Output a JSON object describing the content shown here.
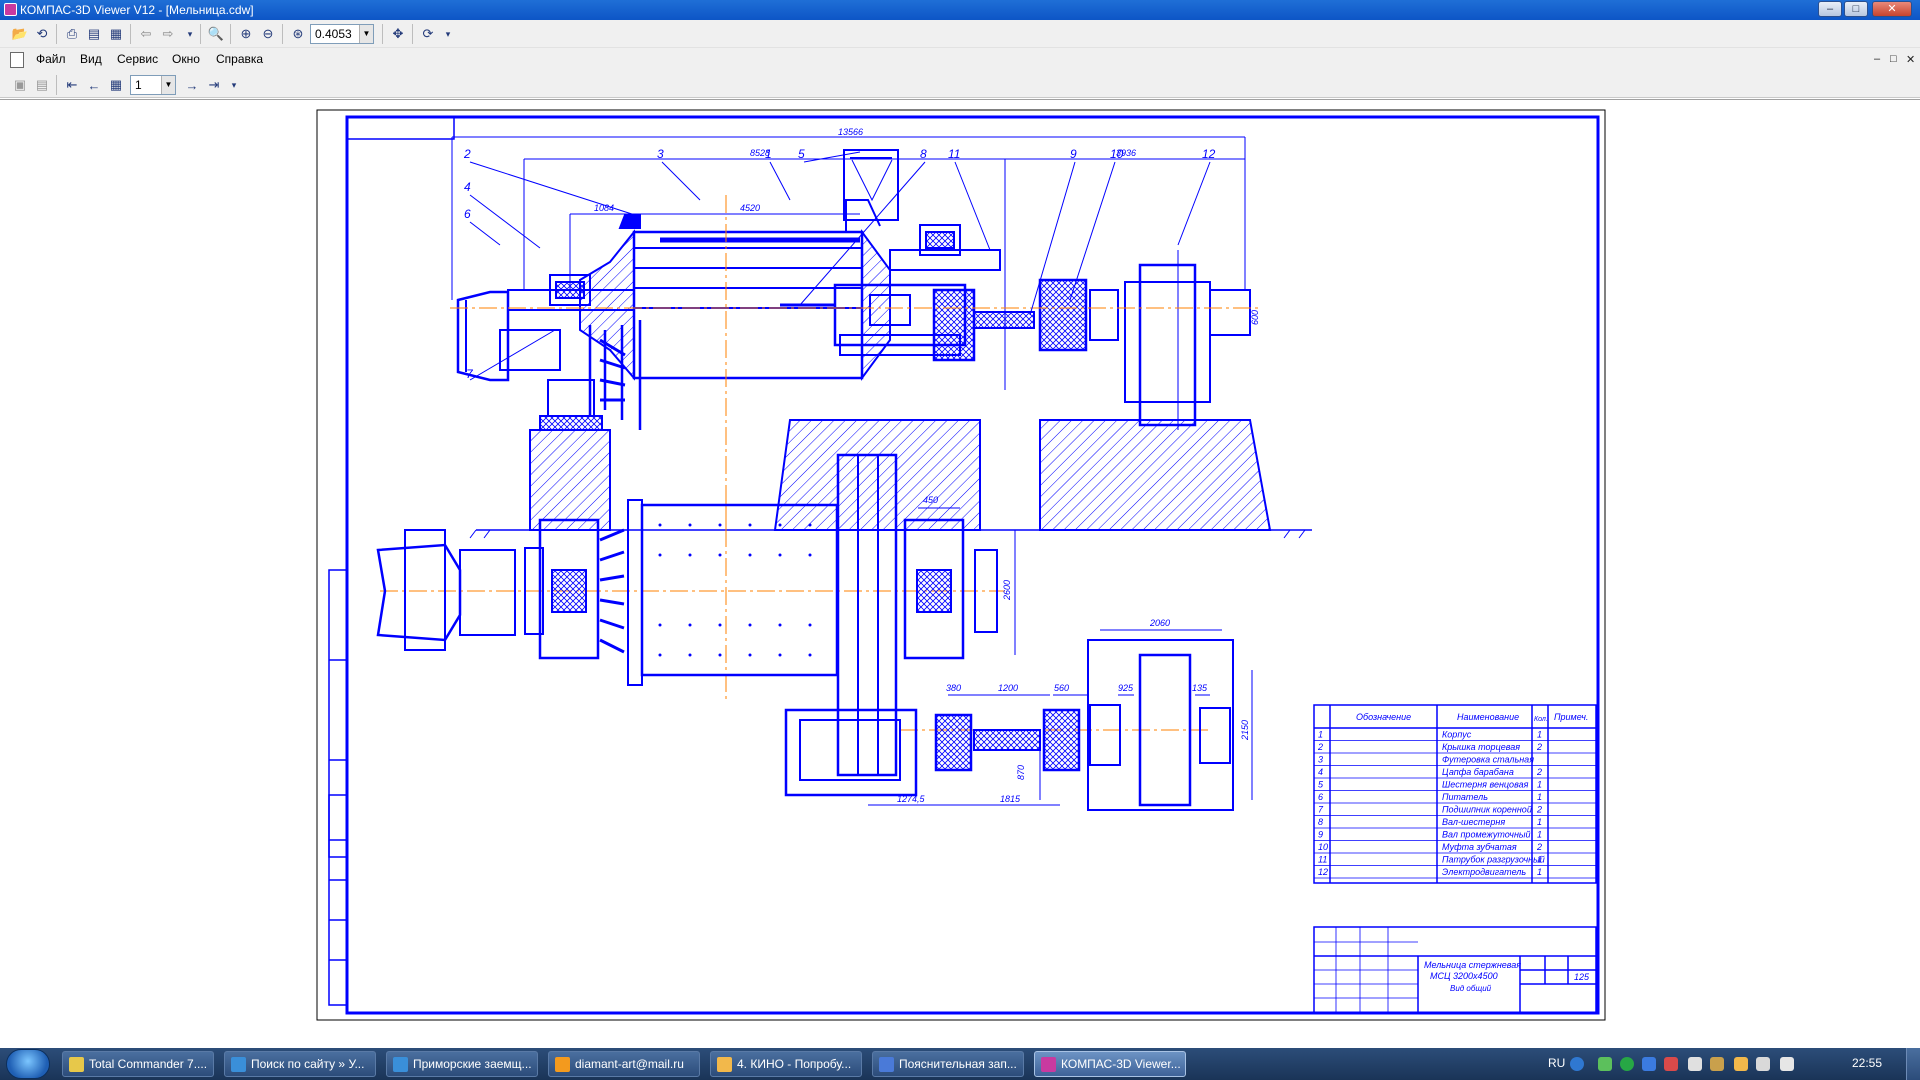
{
  "window": {
    "title": "КОМПАС-3D Viewer V12 - [Мельница.cdw]",
    "controls": {
      "minimize": "–",
      "maximize": "□",
      "close": "✕"
    }
  },
  "toolbar": {
    "zoom_value": "0.4053",
    "page_value": "1"
  },
  "menu": {
    "items": [
      "Файл",
      "Вид",
      "Сервис",
      "Окно",
      "Справка"
    ],
    "mdi_controls": [
      "–",
      "□",
      "✕"
    ]
  },
  "drawing": {
    "dimensions_top": {
      "overall": "13566",
      "left_span": "8528",
      "right_span": "3936",
      "d1": "1084",
      "d2": "4520"
    },
    "dimensions_plan": {
      "d450": "450",
      "d2600": "2600",
      "d2060": "2060",
      "d380": "380",
      "d1200": "1200",
      "d560": "560",
      "d925": "925",
      "d135": "135",
      "d2150": "2150",
      "d870": "870",
      "d1274": "1274,5",
      "d1815": "1815"
    },
    "dimension_600": "600",
    "callouts": [
      "2",
      "4",
      "6",
      "7",
      "3",
      "1",
      "5",
      "8",
      "11",
      "9",
      "10",
      "12"
    ],
    "spec_table": {
      "headers": [
        "Обозначение",
        "Наименование",
        "Кол.",
        "Примеч."
      ],
      "rows": [
        {
          "pos": "1",
          "name": "Корпус",
          "qty": "1"
        },
        {
          "pos": "2",
          "name": "Крышка торцевая",
          "qty": "2"
        },
        {
          "pos": "3",
          "name": "Футеровка стальная",
          "qty": ""
        },
        {
          "pos": "4",
          "name": "Цапфа барабана",
          "qty": "2"
        },
        {
          "pos": "5",
          "name": "Шестерня венцовая",
          "qty": "1"
        },
        {
          "pos": "6",
          "name": "Питатель",
          "qty": "1"
        },
        {
          "pos": "7",
          "name": "Подшипник коренной",
          "qty": "2"
        },
        {
          "pos": "8",
          "name": "Вал-шестерня",
          "qty": "1"
        },
        {
          "pos": "9",
          "name": "Вал промежуточный",
          "qty": "1"
        },
        {
          "pos": "10",
          "name": "Муфта зубчатая",
          "qty": "2"
        },
        {
          "pos": "11",
          "name": "Патрубок разгрузочный",
          "qty": "1"
        },
        {
          "pos": "12",
          "name": "Электродвигатель",
          "qty": "1"
        }
      ]
    },
    "title_block": {
      "name_line1": "Мельница стержневая",
      "name_line2": "МСЦ 3200х4500",
      "name_line3": "Вид общий",
      "mass": "125"
    }
  },
  "taskbar": {
    "items": [
      {
        "label": "Total Commander 7....",
        "color": "#e7c84a"
      },
      {
        "label": "Поиск по сайту » У...",
        "color": "#3a8fd9"
      },
      {
        "label": "Приморские заемщ...",
        "color": "#3a8fd9"
      },
      {
        "label": "diamant-art@mail.ru",
        "color": "#f39a1e"
      },
      {
        "label": "4. КИНО - Попробу...",
        "color": "#f2b84b"
      },
      {
        "label": "Пояснительная зап...",
        "color": "#4a7ad8"
      },
      {
        "label": "КОМПАС-3D Viewer...",
        "color": "#c83aa0"
      }
    ],
    "lang": "RU",
    "clock": "22:55"
  },
  "colors": {
    "drawing_line": "#0000ff",
    "axis_line": "#ff8000",
    "titlebar": "#1f6fd6"
  }
}
